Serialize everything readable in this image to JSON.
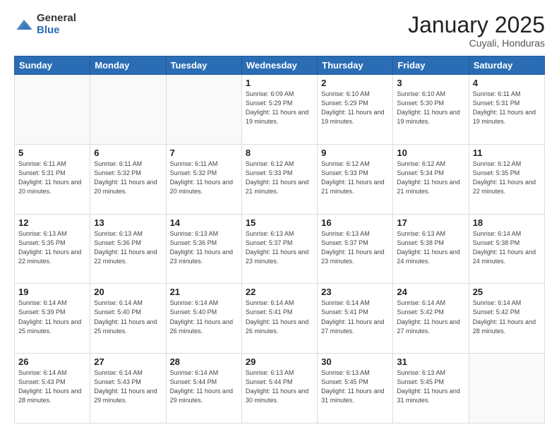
{
  "header": {
    "logo_general": "General",
    "logo_blue": "Blue",
    "month_title": "January 2025",
    "subtitle": "Cuyali, Honduras"
  },
  "weekdays": [
    "Sunday",
    "Monday",
    "Tuesday",
    "Wednesday",
    "Thursday",
    "Friday",
    "Saturday"
  ],
  "weeks": [
    [
      {
        "day": "",
        "sunrise": "",
        "sunset": "",
        "daylight": ""
      },
      {
        "day": "",
        "sunrise": "",
        "sunset": "",
        "daylight": ""
      },
      {
        "day": "",
        "sunrise": "",
        "sunset": "",
        "daylight": ""
      },
      {
        "day": "1",
        "sunrise": "Sunrise: 6:09 AM",
        "sunset": "Sunset: 5:29 PM",
        "daylight": "Daylight: 11 hours and 19 minutes."
      },
      {
        "day": "2",
        "sunrise": "Sunrise: 6:10 AM",
        "sunset": "Sunset: 5:29 PM",
        "daylight": "Daylight: 11 hours and 19 minutes."
      },
      {
        "day": "3",
        "sunrise": "Sunrise: 6:10 AM",
        "sunset": "Sunset: 5:30 PM",
        "daylight": "Daylight: 11 hours and 19 minutes."
      },
      {
        "day": "4",
        "sunrise": "Sunrise: 6:11 AM",
        "sunset": "Sunset: 5:31 PM",
        "daylight": "Daylight: 11 hours and 19 minutes."
      }
    ],
    [
      {
        "day": "5",
        "sunrise": "Sunrise: 6:11 AM",
        "sunset": "Sunset: 5:31 PM",
        "daylight": "Daylight: 11 hours and 20 minutes."
      },
      {
        "day": "6",
        "sunrise": "Sunrise: 6:11 AM",
        "sunset": "Sunset: 5:32 PM",
        "daylight": "Daylight: 11 hours and 20 minutes."
      },
      {
        "day": "7",
        "sunrise": "Sunrise: 6:11 AM",
        "sunset": "Sunset: 5:32 PM",
        "daylight": "Daylight: 11 hours and 20 minutes."
      },
      {
        "day": "8",
        "sunrise": "Sunrise: 6:12 AM",
        "sunset": "Sunset: 5:33 PM",
        "daylight": "Daylight: 11 hours and 21 minutes."
      },
      {
        "day": "9",
        "sunrise": "Sunrise: 6:12 AM",
        "sunset": "Sunset: 5:33 PM",
        "daylight": "Daylight: 11 hours and 21 minutes."
      },
      {
        "day": "10",
        "sunrise": "Sunrise: 6:12 AM",
        "sunset": "Sunset: 5:34 PM",
        "daylight": "Daylight: 11 hours and 21 minutes."
      },
      {
        "day": "11",
        "sunrise": "Sunrise: 6:12 AM",
        "sunset": "Sunset: 5:35 PM",
        "daylight": "Daylight: 11 hours and 22 minutes."
      }
    ],
    [
      {
        "day": "12",
        "sunrise": "Sunrise: 6:13 AM",
        "sunset": "Sunset: 5:35 PM",
        "daylight": "Daylight: 11 hours and 22 minutes."
      },
      {
        "day": "13",
        "sunrise": "Sunrise: 6:13 AM",
        "sunset": "Sunset: 5:36 PM",
        "daylight": "Daylight: 11 hours and 22 minutes."
      },
      {
        "day": "14",
        "sunrise": "Sunrise: 6:13 AM",
        "sunset": "Sunset: 5:36 PM",
        "daylight": "Daylight: 11 hours and 23 minutes."
      },
      {
        "day": "15",
        "sunrise": "Sunrise: 6:13 AM",
        "sunset": "Sunset: 5:37 PM",
        "daylight": "Daylight: 11 hours and 23 minutes."
      },
      {
        "day": "16",
        "sunrise": "Sunrise: 6:13 AM",
        "sunset": "Sunset: 5:37 PM",
        "daylight": "Daylight: 11 hours and 23 minutes."
      },
      {
        "day": "17",
        "sunrise": "Sunrise: 6:13 AM",
        "sunset": "Sunset: 5:38 PM",
        "daylight": "Daylight: 11 hours and 24 minutes."
      },
      {
        "day": "18",
        "sunrise": "Sunrise: 6:14 AM",
        "sunset": "Sunset: 5:38 PM",
        "daylight": "Daylight: 11 hours and 24 minutes."
      }
    ],
    [
      {
        "day": "19",
        "sunrise": "Sunrise: 6:14 AM",
        "sunset": "Sunset: 5:39 PM",
        "daylight": "Daylight: 11 hours and 25 minutes."
      },
      {
        "day": "20",
        "sunrise": "Sunrise: 6:14 AM",
        "sunset": "Sunset: 5:40 PM",
        "daylight": "Daylight: 11 hours and 25 minutes."
      },
      {
        "day": "21",
        "sunrise": "Sunrise: 6:14 AM",
        "sunset": "Sunset: 5:40 PM",
        "daylight": "Daylight: 11 hours and 26 minutes."
      },
      {
        "day": "22",
        "sunrise": "Sunrise: 6:14 AM",
        "sunset": "Sunset: 5:41 PM",
        "daylight": "Daylight: 11 hours and 26 minutes."
      },
      {
        "day": "23",
        "sunrise": "Sunrise: 6:14 AM",
        "sunset": "Sunset: 5:41 PM",
        "daylight": "Daylight: 11 hours and 27 minutes."
      },
      {
        "day": "24",
        "sunrise": "Sunrise: 6:14 AM",
        "sunset": "Sunset: 5:42 PM",
        "daylight": "Daylight: 11 hours and 27 minutes."
      },
      {
        "day": "25",
        "sunrise": "Sunrise: 6:14 AM",
        "sunset": "Sunset: 5:42 PM",
        "daylight": "Daylight: 11 hours and 28 minutes."
      }
    ],
    [
      {
        "day": "26",
        "sunrise": "Sunrise: 6:14 AM",
        "sunset": "Sunset: 5:43 PM",
        "daylight": "Daylight: 11 hours and 28 minutes."
      },
      {
        "day": "27",
        "sunrise": "Sunrise: 6:14 AM",
        "sunset": "Sunset: 5:43 PM",
        "daylight": "Daylight: 11 hours and 29 minutes."
      },
      {
        "day": "28",
        "sunrise": "Sunrise: 6:14 AM",
        "sunset": "Sunset: 5:44 PM",
        "daylight": "Daylight: 11 hours and 29 minutes."
      },
      {
        "day": "29",
        "sunrise": "Sunrise: 6:13 AM",
        "sunset": "Sunset: 5:44 PM",
        "daylight": "Daylight: 11 hours and 30 minutes."
      },
      {
        "day": "30",
        "sunrise": "Sunrise: 6:13 AM",
        "sunset": "Sunset: 5:45 PM",
        "daylight": "Daylight: 11 hours and 31 minutes."
      },
      {
        "day": "31",
        "sunrise": "Sunrise: 6:13 AM",
        "sunset": "Sunset: 5:45 PM",
        "daylight": "Daylight: 11 hours and 31 minutes."
      },
      {
        "day": "",
        "sunrise": "",
        "sunset": "",
        "daylight": ""
      }
    ]
  ]
}
